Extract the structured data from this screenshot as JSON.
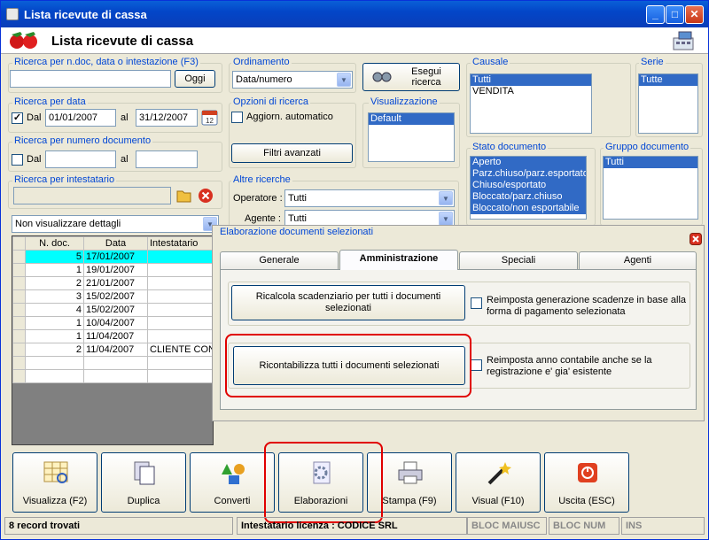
{
  "title": "Lista ricevute di cassa",
  "header_title": "Lista ricevute di cassa",
  "search": {
    "label": "Ricerca per n.doc, data o intestazione (F3)",
    "value": "",
    "oggi": "Oggi"
  },
  "date_search": {
    "label": "Ricerca per data",
    "dal": "Dal",
    "al": "al",
    "from": "01/01/2007",
    "to": "31/12/2007",
    "checked": "✓"
  },
  "num_search": {
    "label": "Ricerca per numero documento",
    "dal": "Dal",
    "al": "al"
  },
  "holder_search": {
    "label": "Ricerca per intestatario"
  },
  "details_select": "Non visualizzare dettagli",
  "ordering": {
    "label": "Ordinamento",
    "value": "Data/numero"
  },
  "execute_btn": "Esegui ricerca",
  "options": {
    "label": "Opzioni di ricerca",
    "auto": "Aggiorn. automatico",
    "filters": "Filtri avanzati"
  },
  "view": {
    "label": "Visualizzazione",
    "items": [
      "Default"
    ]
  },
  "other": {
    "label": "Altre ricerche",
    "operatore": "Operatore :",
    "agente": "Agente :",
    "op_value": "Tutti",
    "ag_value": "Tutti"
  },
  "causale": {
    "label": "Causale",
    "items": [
      "Tutti",
      "VENDITA"
    ]
  },
  "serie": {
    "label": "Serie",
    "items": [
      "Tutte"
    ]
  },
  "stato": {
    "label": "Stato documento",
    "items": [
      "Aperto",
      "Parz.chiuso/parz.esportato",
      "Chiuso/esportato",
      "Bloccato/parz.chiuso",
      "Bloccato/non esportabile"
    ]
  },
  "gruppo": {
    "label": "Gruppo documento",
    "items": [
      "Tutti"
    ]
  },
  "table": {
    "headers": [
      "N. doc.",
      "Data",
      "Intestatario"
    ],
    "rows": [
      [
        "5",
        "17/01/2007",
        ""
      ],
      [
        "1",
        "19/01/2007",
        ""
      ],
      [
        "2",
        "21/01/2007",
        ""
      ],
      [
        "3",
        "15/02/2007",
        ""
      ],
      [
        "4",
        "15/02/2007",
        ""
      ],
      [
        "1",
        "10/04/2007",
        ""
      ],
      [
        "1",
        "11/04/2007",
        ""
      ],
      [
        "2",
        "11/04/2007",
        "CLIENTE CON"
      ]
    ]
  },
  "panel": {
    "title": "Elaborazione documenti selezionati",
    "tabs": [
      "Generale",
      "Amministrazione",
      "Speciali",
      "Agenti"
    ],
    "btn1": "Ricalcola scadenziario per tutti i documenti selezionati",
    "chk1": "Reimposta generazione scadenze in base alla forma di pagamento selezionata",
    "btn2": "Ricontabilizza tutti i documenti selezionati",
    "chk2": "Reimposta anno contabile anche se la registrazione e' gia' esistente"
  },
  "toolbar": [
    "Visualizza (F2)",
    "Duplica",
    "Converti",
    "Elaborazioni",
    "Stampa (F9)",
    "Visual (F10)",
    "Uscita (ESC)"
  ],
  "statusbar": {
    "records": "8 record trovati",
    "license": "Intestatario licenza : CODICE SRL",
    "caps": "BLOC MAIUSC",
    "num": "BLOC NUM",
    "ins": "INS"
  },
  "colors": {
    "accent": "#0046d5",
    "selection": "#316ac5",
    "highlight": "#00ffff",
    "annotation": "#e00000"
  }
}
